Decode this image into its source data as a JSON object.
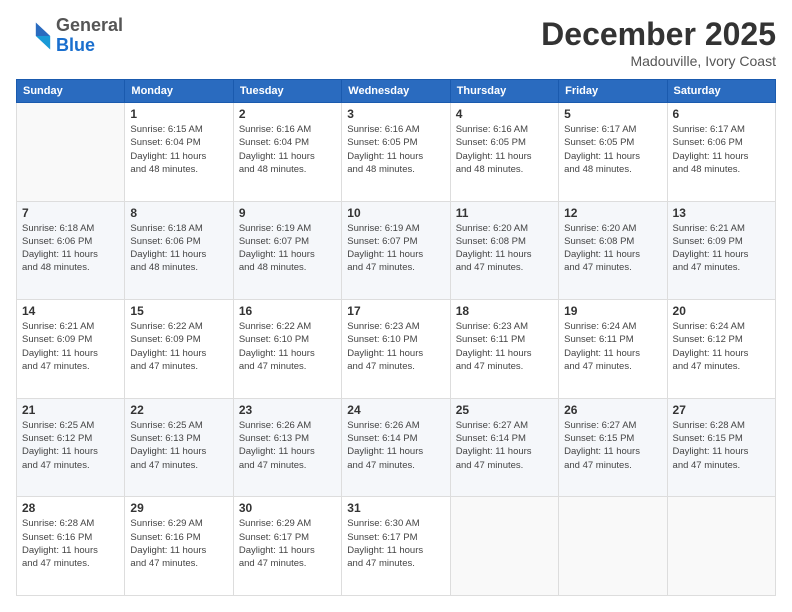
{
  "header": {
    "logo_general": "General",
    "logo_blue": "Blue",
    "month_title": "December 2025",
    "subtitle": "Madouville, Ivory Coast"
  },
  "calendar": {
    "days_of_week": [
      "Sunday",
      "Monday",
      "Tuesday",
      "Wednesday",
      "Thursday",
      "Friday",
      "Saturday"
    ],
    "weeks": [
      [
        {
          "day": "",
          "info": ""
        },
        {
          "day": "1",
          "info": "Sunrise: 6:15 AM\nSunset: 6:04 PM\nDaylight: 11 hours\nand 48 minutes."
        },
        {
          "day": "2",
          "info": "Sunrise: 6:16 AM\nSunset: 6:04 PM\nDaylight: 11 hours\nand 48 minutes."
        },
        {
          "day": "3",
          "info": "Sunrise: 6:16 AM\nSunset: 6:05 PM\nDaylight: 11 hours\nand 48 minutes."
        },
        {
          "day": "4",
          "info": "Sunrise: 6:16 AM\nSunset: 6:05 PM\nDaylight: 11 hours\nand 48 minutes."
        },
        {
          "day": "5",
          "info": "Sunrise: 6:17 AM\nSunset: 6:05 PM\nDaylight: 11 hours\nand 48 minutes."
        },
        {
          "day": "6",
          "info": "Sunrise: 6:17 AM\nSunset: 6:06 PM\nDaylight: 11 hours\nand 48 minutes."
        }
      ],
      [
        {
          "day": "7",
          "info": "Sunrise: 6:18 AM\nSunset: 6:06 PM\nDaylight: 11 hours\nand 48 minutes."
        },
        {
          "day": "8",
          "info": "Sunrise: 6:18 AM\nSunset: 6:06 PM\nDaylight: 11 hours\nand 48 minutes."
        },
        {
          "day": "9",
          "info": "Sunrise: 6:19 AM\nSunset: 6:07 PM\nDaylight: 11 hours\nand 48 minutes."
        },
        {
          "day": "10",
          "info": "Sunrise: 6:19 AM\nSunset: 6:07 PM\nDaylight: 11 hours\nand 47 minutes."
        },
        {
          "day": "11",
          "info": "Sunrise: 6:20 AM\nSunset: 6:08 PM\nDaylight: 11 hours\nand 47 minutes."
        },
        {
          "day": "12",
          "info": "Sunrise: 6:20 AM\nSunset: 6:08 PM\nDaylight: 11 hours\nand 47 minutes."
        },
        {
          "day": "13",
          "info": "Sunrise: 6:21 AM\nSunset: 6:09 PM\nDaylight: 11 hours\nand 47 minutes."
        }
      ],
      [
        {
          "day": "14",
          "info": "Sunrise: 6:21 AM\nSunset: 6:09 PM\nDaylight: 11 hours\nand 47 minutes."
        },
        {
          "day": "15",
          "info": "Sunrise: 6:22 AM\nSunset: 6:09 PM\nDaylight: 11 hours\nand 47 minutes."
        },
        {
          "day": "16",
          "info": "Sunrise: 6:22 AM\nSunset: 6:10 PM\nDaylight: 11 hours\nand 47 minutes."
        },
        {
          "day": "17",
          "info": "Sunrise: 6:23 AM\nSunset: 6:10 PM\nDaylight: 11 hours\nand 47 minutes."
        },
        {
          "day": "18",
          "info": "Sunrise: 6:23 AM\nSunset: 6:11 PM\nDaylight: 11 hours\nand 47 minutes."
        },
        {
          "day": "19",
          "info": "Sunrise: 6:24 AM\nSunset: 6:11 PM\nDaylight: 11 hours\nand 47 minutes."
        },
        {
          "day": "20",
          "info": "Sunrise: 6:24 AM\nSunset: 6:12 PM\nDaylight: 11 hours\nand 47 minutes."
        }
      ],
      [
        {
          "day": "21",
          "info": "Sunrise: 6:25 AM\nSunset: 6:12 PM\nDaylight: 11 hours\nand 47 minutes."
        },
        {
          "day": "22",
          "info": "Sunrise: 6:25 AM\nSunset: 6:13 PM\nDaylight: 11 hours\nand 47 minutes."
        },
        {
          "day": "23",
          "info": "Sunrise: 6:26 AM\nSunset: 6:13 PM\nDaylight: 11 hours\nand 47 minutes."
        },
        {
          "day": "24",
          "info": "Sunrise: 6:26 AM\nSunset: 6:14 PM\nDaylight: 11 hours\nand 47 minutes."
        },
        {
          "day": "25",
          "info": "Sunrise: 6:27 AM\nSunset: 6:14 PM\nDaylight: 11 hours\nand 47 minutes."
        },
        {
          "day": "26",
          "info": "Sunrise: 6:27 AM\nSunset: 6:15 PM\nDaylight: 11 hours\nand 47 minutes."
        },
        {
          "day": "27",
          "info": "Sunrise: 6:28 AM\nSunset: 6:15 PM\nDaylight: 11 hours\nand 47 minutes."
        }
      ],
      [
        {
          "day": "28",
          "info": "Sunrise: 6:28 AM\nSunset: 6:16 PM\nDaylight: 11 hours\nand 47 minutes."
        },
        {
          "day": "29",
          "info": "Sunrise: 6:29 AM\nSunset: 6:16 PM\nDaylight: 11 hours\nand 47 minutes."
        },
        {
          "day": "30",
          "info": "Sunrise: 6:29 AM\nSunset: 6:17 PM\nDaylight: 11 hours\nand 47 minutes."
        },
        {
          "day": "31",
          "info": "Sunrise: 6:30 AM\nSunset: 6:17 PM\nDaylight: 11 hours\nand 47 minutes."
        },
        {
          "day": "",
          "info": ""
        },
        {
          "day": "",
          "info": ""
        },
        {
          "day": "",
          "info": ""
        }
      ]
    ]
  }
}
